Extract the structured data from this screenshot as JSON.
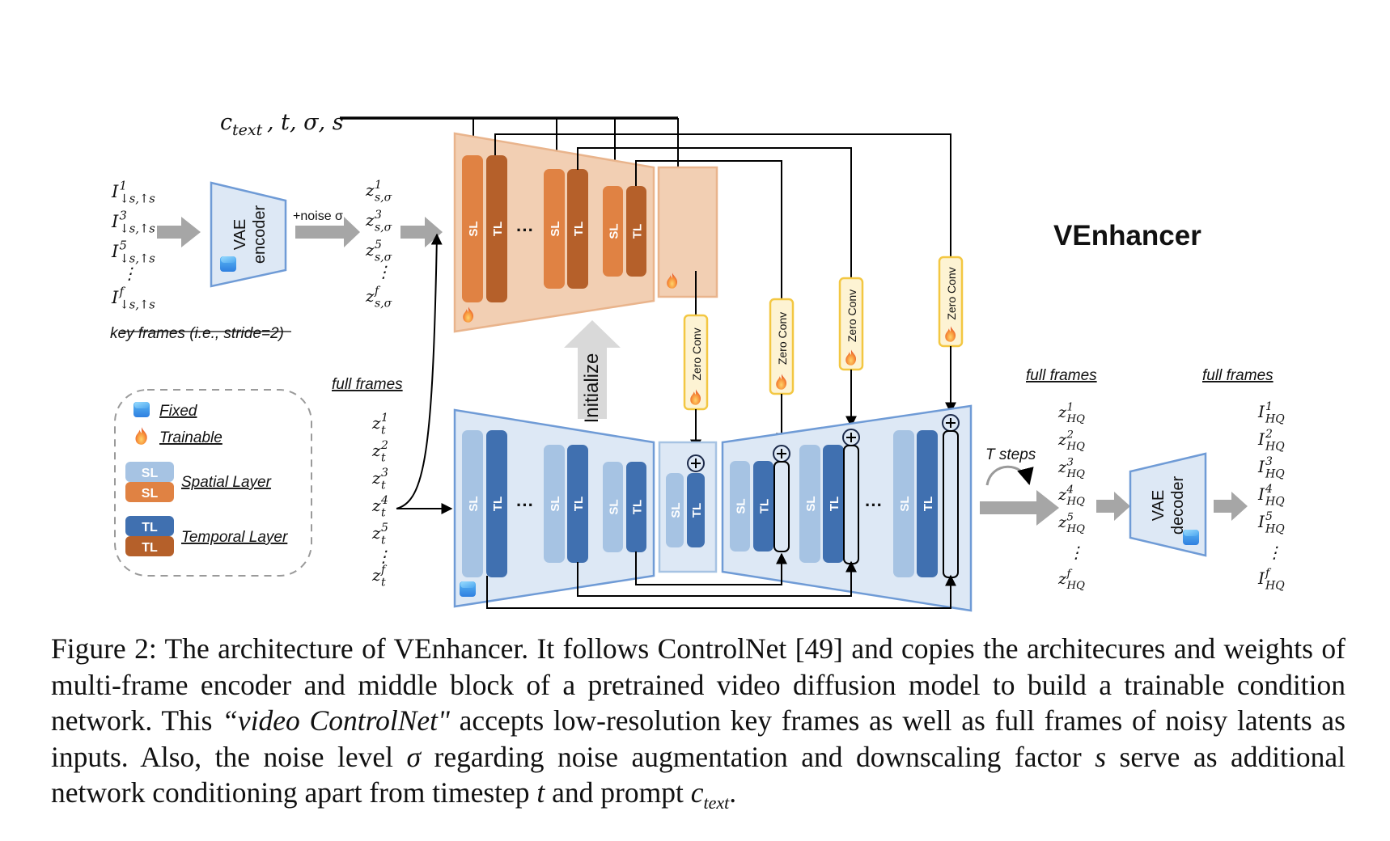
{
  "diagram": {
    "title": "VEnhancer",
    "conditioning_label": "c_text, t, σ, s",
    "conditioning_parts": {
      "c": "c",
      "c_sub": "text",
      "rest": ", t, σ, s"
    },
    "inputs": {
      "key_frame_labels": [
        {
          "base": "I",
          "sup": "1",
          "sub": "↓s,↑s"
        },
        {
          "base": "I",
          "sup": "3",
          "sub": "↓s,↑s"
        },
        {
          "base": "I",
          "sup": "5",
          "sub": "↓s,↑s"
        },
        {
          "base": "I",
          "sup": "f",
          "sub": "↓s,↑s"
        }
      ],
      "key_frames_caption": "key frames (i.e., stride=2)",
      "vae_encoder_line1": "VAE",
      "vae_encoder_line2": "encoder",
      "noise_label": "+noise σ",
      "noisy_latents": [
        {
          "base": "z",
          "sup": "1",
          "sub": "s,σ"
        },
        {
          "base": "z",
          "sup": "3",
          "sub": "s,σ"
        },
        {
          "base": "z",
          "sup": "5",
          "sub": "s,σ"
        },
        {
          "base": "z",
          "sup": "f",
          "sub": "s,σ"
        }
      ]
    },
    "full_frames_label": "full frames",
    "full_frame_latents": [
      {
        "base": "z",
        "sup": "1",
        "sub": "t"
      },
      {
        "base": "z",
        "sup": "2",
        "sub": "t"
      },
      {
        "base": "z",
        "sup": "3",
        "sub": "t"
      },
      {
        "base": "z",
        "sup": "4",
        "sub": "t"
      },
      {
        "base": "z",
        "sup": "5",
        "sub": "t"
      },
      {
        "base": "z",
        "sup": "f",
        "sub": "t"
      }
    ],
    "layer_labels": {
      "spatial": "SL",
      "temporal": "TL",
      "ellipsis": "···"
    },
    "zero_conv_label": "Zero Conv",
    "initialize_label": "Initialize",
    "t_steps_label": "T steps",
    "hq_latents_label": "full frames",
    "hq_latents": [
      {
        "base": "z",
        "sup": "1",
        "sub": "HQ"
      },
      {
        "base": "z",
        "sup": "2",
        "sub": "HQ"
      },
      {
        "base": "z",
        "sup": "3",
        "sub": "HQ"
      },
      {
        "base": "z",
        "sup": "4",
        "sub": "HQ"
      },
      {
        "base": "z",
        "sup": "5",
        "sub": "HQ"
      },
      {
        "base": "z",
        "sup": "f",
        "sub": "HQ"
      }
    ],
    "vae_decoder_line1": "VAE",
    "vae_decoder_line2": "decoder",
    "output_label": "full frames",
    "outputs": [
      {
        "base": "I",
        "sup": "1",
        "sub": "HQ"
      },
      {
        "base": "I",
        "sup": "2",
        "sub": "HQ"
      },
      {
        "base": "I",
        "sup": "3",
        "sub": "HQ"
      },
      {
        "base": "I",
        "sup": "4",
        "sub": "HQ"
      },
      {
        "base": "I",
        "sup": "5",
        "sub": "HQ"
      },
      {
        "base": "I",
        "sup": "f",
        "sub": "HQ"
      }
    ],
    "legend": {
      "fixed": "Fixed",
      "trainable": "Trainable",
      "spatial_layer": "Spatial Layer",
      "temporal_layer": "Temporal Layer",
      "sl": "SL",
      "tl": "TL"
    },
    "colors": {
      "orange_bg": "#f2cfb3",
      "orange_border": "#e9b48c",
      "orange_sl": "#e08243",
      "orange_tl": "#b5602a",
      "blue_bg": "#dde8f5",
      "blue_border": "#6f9bd6",
      "blue_sl": "#a6c3e3",
      "blue_tl": "#4070b0",
      "zero_conv_bg": "#fdf3d3",
      "zero_conv_border": "#f3c742",
      "arrow_gray": "#a6a6a6",
      "init_gray": "#d9d9d9"
    }
  },
  "caption": {
    "lead": "Figure 2: The architecture of VEnhancer. It follows ControlNet [49] and copies the architecures and weights of multi-frame encoder and middle block of a pretrained video diffusion model to build a trainable condition network. This ",
    "italic": "“video ControlNet\"",
    "mid1": " accepts low-resolution key frames as well as full frames of noisy latents as inputs. Also, the noise level ",
    "sigma": "σ",
    "mid2": " regarding noise augmentation and downscaling factor ",
    "s": "s",
    "mid3": " serve as additional network conditioning apart from timestep ",
    "t": "t",
    "mid4": " and prompt ",
    "ctext_c": "c",
    "ctext_sub": "text",
    "end": "."
  }
}
